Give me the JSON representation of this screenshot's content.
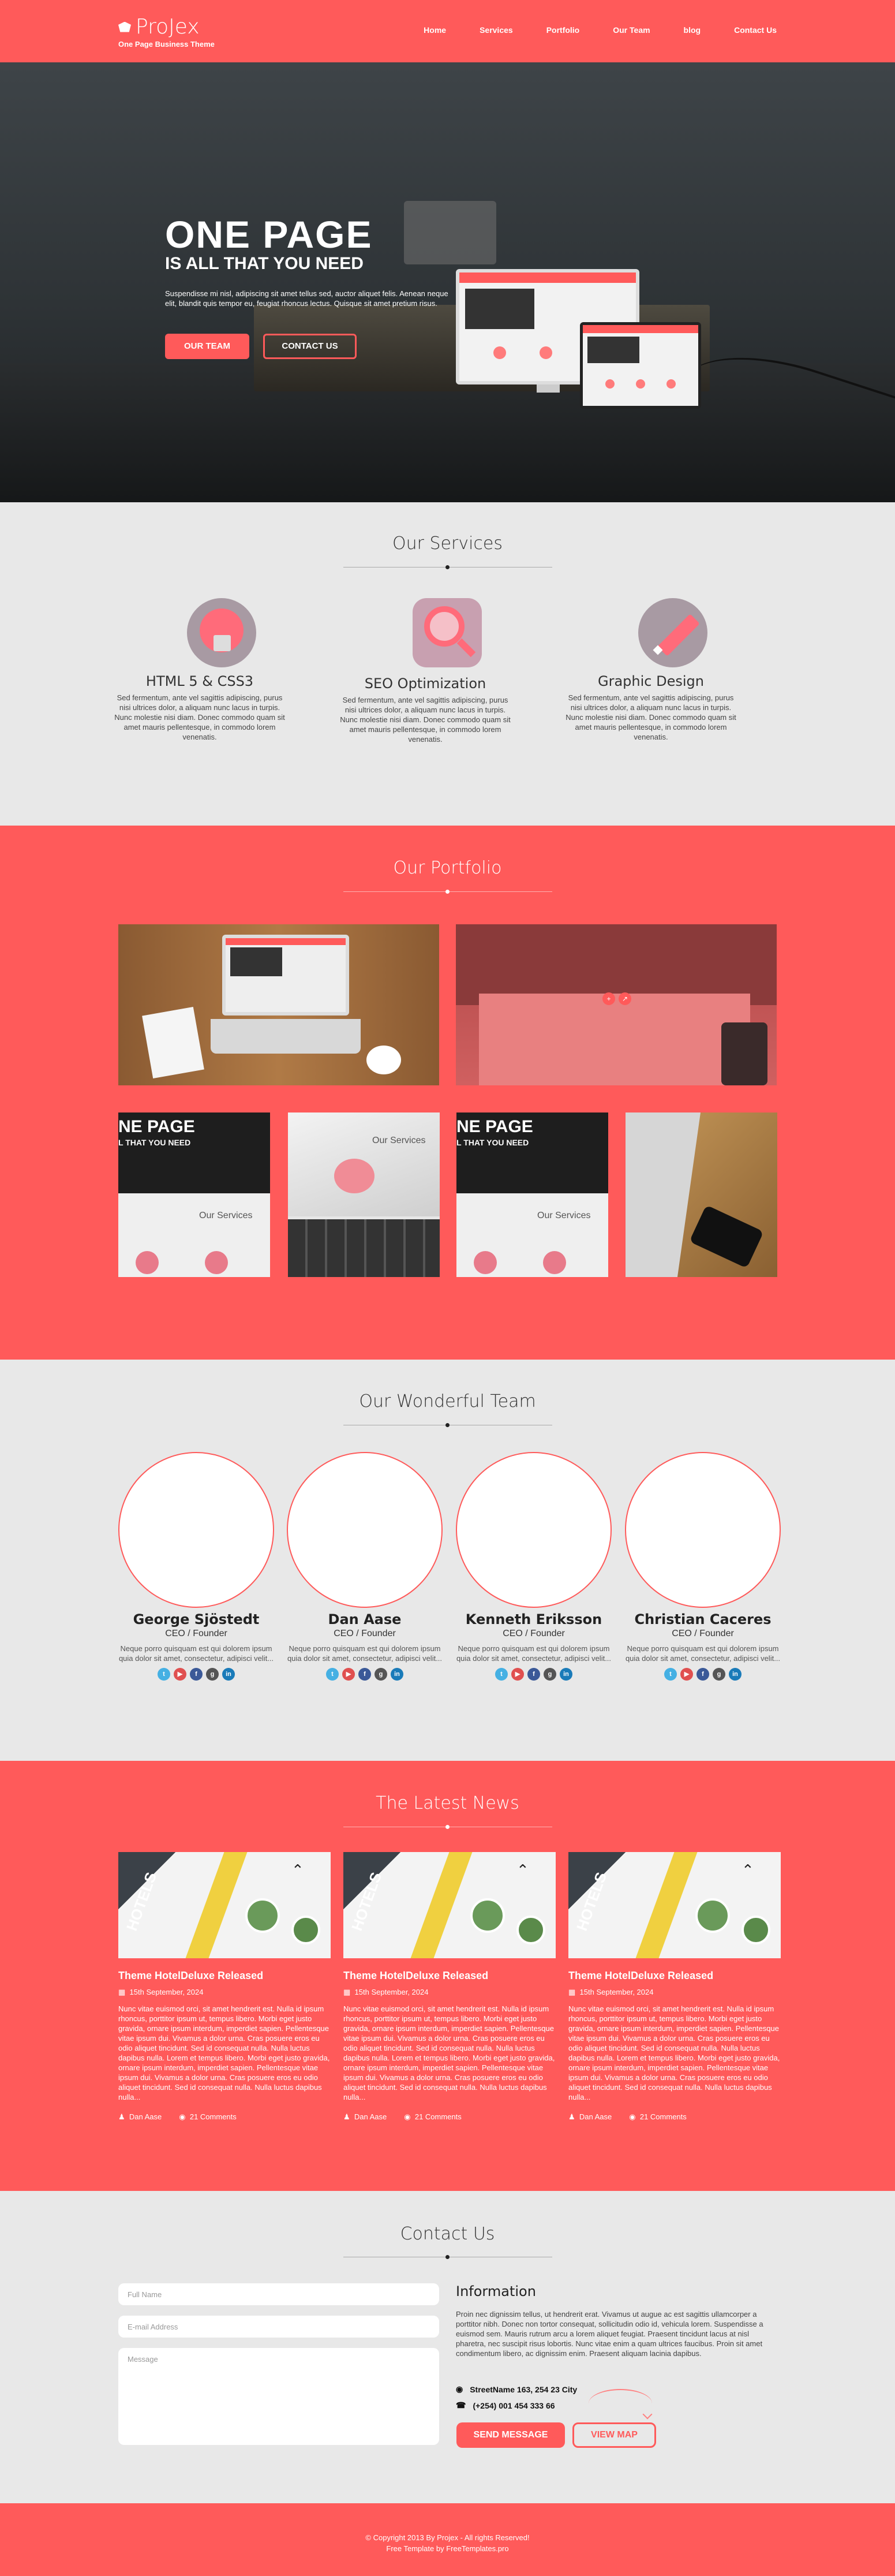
{
  "brand": {
    "name": "ProJex",
    "tagline": "One Page Business Theme"
  },
  "nav": {
    "items": [
      "Home",
      "Services",
      "Portfolio",
      "Our Team",
      "blog",
      "Contact Us"
    ]
  },
  "hero": {
    "title": "ONE PAGE",
    "subtitle": "IS ALL THAT YOU NEED",
    "text": "Suspendisse mi nisl, adipiscing sit amet tellus sed, auctor aliquet felis. Aenean neque elit, blandit quis tempor eu, feugiat rhoncus lectus. Quisque sit amet pretium risus.",
    "btn_team": "OUR TEAM",
    "btn_contact": "CONTACT US"
  },
  "services": {
    "title": "Our Services",
    "items": [
      {
        "title": "HTML 5 & CSS3",
        "text": "Sed fermentum, ante vel sagittis adipiscing, purus nisi ultrices dolor, a aliquam nunc lacus in turpis. Nunc molestie nisi diam. Donec commodo quam sit amet mauris pellentesque, in commodo lorem venenatis."
      },
      {
        "title": "SEO Optimization",
        "text": "Sed fermentum, ante vel sagittis adipiscing, purus nisi ultrices dolor, a aliquam nunc lacus in turpis. Nunc molestie nisi diam. Donec commodo quam sit amet mauris pellentesque, in commodo lorem venenatis."
      },
      {
        "title": "Graphic Design",
        "text": "Sed fermentum, ante vel sagittis adipiscing, purus nisi ultrices dolor, a aliquam nunc lacus in turpis. Nunc molestie nisi diam. Donec commodo quam sit amet mauris pellentesque, in commodo lorem venenatis."
      }
    ]
  },
  "portfolio": {
    "title": "Our Portfolio",
    "thumb_big_text": [
      "NE PAGE",
      "L THAT YOU NEED"
    ],
    "thumb_small_text": "Our Services"
  },
  "team": {
    "title": "Our Wonderful Team",
    "members": [
      {
        "name": "George Sjöstedt",
        "role": "CEO / Founder",
        "text": "Neque porro quisquam est qui dolorem ipsum quia dolor sit amet, consectetur, adipisci velit..."
      },
      {
        "name": "Dan Aase",
        "role": "CEO / Founder",
        "text": "Neque porro quisquam est qui dolorem ipsum quia dolor sit amet, consectetur, adipisci velit..."
      },
      {
        "name": "Kenneth Eriksson",
        "role": "CEO / Founder",
        "text": "Neque porro quisquam est qui dolorem ipsum quia dolor sit amet, consectetur, adipisci velit..."
      },
      {
        "name": "Christian Caceres",
        "role": "CEO / Founder",
        "text": "Neque porro quisquam est qui dolorem ipsum quia dolor sit amet, consectetur, adipisci velit..."
      }
    ],
    "social_colors": [
      "#45b0e3",
      "#e05050",
      "#3b5998",
      "#555555",
      "#1a7bb9"
    ],
    "social_icons": [
      "twitter-icon",
      "youtube-icon",
      "facebook-icon",
      "google-plus-icon",
      "linkedin-icon"
    ]
  },
  "news": {
    "title": "The Latest News",
    "items": [
      {
        "title": "Theme HotelDeluxe Released",
        "date": "15th September, 2024",
        "text": "Nunc vitae euismod orci, sit amet hendrerit est. Nulla id ipsum rhoncus, porttitor ipsum ut, tempus libero. Morbi eget justo gravida, ornare ipsum interdum, imperdiet sapien. Pellentesque vitae ipsum dui. Vivamus a dolor urna. Cras posuere eros eu odio aliquet tincidunt. Sed id consequat nulla. Nulla luctus dapibus nulla. Lorem et tempus libero. Morbi eget justo gravida, ornare ipsum interdum, imperdiet sapien. Pellentesque vitae ipsum dui. Vivamus a dolor urna. Cras posuere eros eu odio aliquet tincidunt. Sed id consequat nulla. Nulla luctus dapibus nulla...",
        "author": "Dan Aase",
        "comments": "21 Comments",
        "img_text": "HOTELS"
      },
      {
        "title": "Theme HotelDeluxe Released",
        "date": "15th September, 2024",
        "text": "Nunc vitae euismod orci, sit amet hendrerit est. Nulla id ipsum rhoncus, porttitor ipsum ut, tempus libero. Morbi eget justo gravida, ornare ipsum interdum, imperdiet sapien. Pellentesque vitae ipsum dui. Vivamus a dolor urna. Cras posuere eros eu odio aliquet tincidunt. Sed id consequat nulla. Nulla luctus dapibus nulla. Lorem et tempus libero. Morbi eget justo gravida, ornare ipsum interdum, imperdiet sapien. Pellentesque vitae ipsum dui. Vivamus a dolor urna. Cras posuere eros eu odio aliquet tincidunt. Sed id consequat nulla. Nulla luctus dapibus nulla...",
        "author": "Dan Aase",
        "comments": "21 Comments",
        "img_text": "HOTELS"
      },
      {
        "title": "Theme HotelDeluxe Released",
        "date": "15th September, 2024",
        "text": "Nunc vitae euismod orci, sit amet hendrerit est. Nulla id ipsum rhoncus, porttitor ipsum ut, tempus libero. Morbi eget justo gravida, ornare ipsum interdum, imperdiet sapien. Pellentesque vitae ipsum dui. Vivamus a dolor urna. Cras posuere eros eu odio aliquet tincidunt. Sed id consequat nulla. Nulla luctus dapibus nulla. Lorem et tempus libero. Morbi eget justo gravida, ornare ipsum interdum, imperdiet sapien. Pellentesque vitae ipsum dui. Vivamus a dolor urna. Cras posuere eros eu odio aliquet tincidunt. Sed id consequat nulla. Nulla luctus dapibus nulla...",
        "author": "Dan Aase",
        "comments": "21 Comments",
        "img_text": "HOTELS"
      }
    ]
  },
  "contact": {
    "title": "Contact Us",
    "name_placeholder": "Full Name",
    "email_placeholder": "E-mail Address",
    "message_placeholder": "Message",
    "info_title": "Information",
    "info_text": "Proin nec dignissim tellus, ut hendrerit erat. Vivamus ut augue ac est sagittis ullamcorper a porttitor nibh. Donec non tortor consequat, sollicitudin odio id, vehicula lorem. Suspendisse a euismod sem. Mauris rutrum arcu a lorem aliquet feugiat. Praesent tincidunt lacus at nisl pharetra, nec suscipit risus lobortis. Nunc vitae enim a quam ultrices faucibus. Proin sit amet condimentum libero, ac dignissim enim. Praesent aliquam lacinia dapibus.",
    "address": "StreetName 163, 254 23 City",
    "phone": "(+254) 001 454 333 66",
    "send_label": "SEND MESSAGE",
    "map_label": "VIEW MAP"
  },
  "footer": {
    "copyright": "© Copyright 2013 By Projex - All rights Reserved!",
    "credit": "Free Template by FreeTemplates.pro"
  },
  "colors": {
    "accent": "#ff5a5a",
    "section_bg": "#e8e8e8"
  }
}
